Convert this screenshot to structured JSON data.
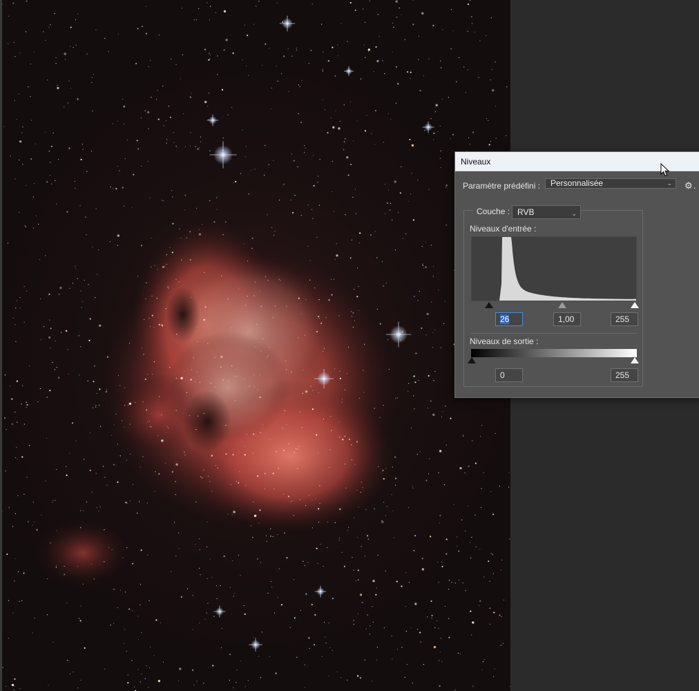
{
  "dialog": {
    "title": "Niveaux",
    "preset_label": "Paramètre prédéfini :",
    "preset_value": "Personnalisée",
    "channel_label": "Couche :",
    "channel_value": "RVB",
    "input_levels_label": "Niveaux d'entrée :",
    "input_black": "26",
    "input_gamma": "1,00",
    "input_white": "255",
    "output_levels_label": "Niveaux de sortie :",
    "output_black": "0",
    "output_white": "255"
  },
  "icons": {
    "gear": "gear-icon",
    "dropdown": "chevron-down-icon",
    "cursor": "mouse-cursor-icon"
  },
  "colors": {
    "dialog_bg": "#535353",
    "titlebar_bg": "#eef2f7",
    "workspace_bg": "#2b2b2b",
    "nebula": "#d05a4c",
    "selection": "#2f6ac6"
  }
}
